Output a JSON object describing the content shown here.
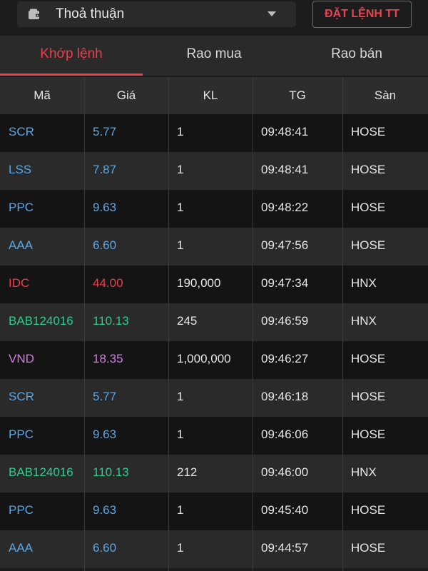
{
  "header": {
    "select_label": "Thoả thuận",
    "order_button_label": "ĐẶT LỆNH TT"
  },
  "tabs": [
    {
      "label": "Khớp lệnh",
      "active": true
    },
    {
      "label": "Rao mua",
      "active": false
    },
    {
      "label": "Rao bán",
      "active": false
    }
  ],
  "table": {
    "columns": [
      "Mã",
      "Giá",
      "KL",
      "TG",
      "Sàn"
    ],
    "colors": {
      "blue": "#5aa6e6",
      "red": "#ee3d4b",
      "green": "#2ecc8f",
      "purple": "#d678e8"
    },
    "rows": [
      {
        "symbol": "SCR",
        "price": "5.77",
        "volume": "1",
        "time": "09:48:41",
        "exchange": "HOSE",
        "color": "blue"
      },
      {
        "symbol": "LSS",
        "price": "7.87",
        "volume": "1",
        "time": "09:48:41",
        "exchange": "HOSE",
        "color": "blue"
      },
      {
        "symbol": "PPC",
        "price": "9.63",
        "volume": "1",
        "time": "09:48:22",
        "exchange": "HOSE",
        "color": "blue"
      },
      {
        "symbol": "AAA",
        "price": "6.60",
        "volume": "1",
        "time": "09:47:56",
        "exchange": "HOSE",
        "color": "blue"
      },
      {
        "symbol": "IDC",
        "price": "44.00",
        "volume": "190,000",
        "time": "09:47:34",
        "exchange": "HNX",
        "color": "red"
      },
      {
        "symbol": "BAB124016",
        "price": "110.13",
        "volume": "245",
        "time": "09:46:59",
        "exchange": "HNX",
        "color": "green"
      },
      {
        "symbol": "VND",
        "price": "18.35",
        "volume": "1,000,000",
        "time": "09:46:27",
        "exchange": "HOSE",
        "color": "purple"
      },
      {
        "symbol": "SCR",
        "price": "5.77",
        "volume": "1",
        "time": "09:46:18",
        "exchange": "HOSE",
        "color": "blue"
      },
      {
        "symbol": "PPC",
        "price": "9.63",
        "volume": "1",
        "time": "09:46:06",
        "exchange": "HOSE",
        "color": "blue"
      },
      {
        "symbol": "BAB124016",
        "price": "110.13",
        "volume": "212",
        "time": "09:46:00",
        "exchange": "HNX",
        "color": "green"
      },
      {
        "symbol": "PPC",
        "price": "9.63",
        "volume": "1",
        "time": "09:45:40",
        "exchange": "HOSE",
        "color": "blue"
      },
      {
        "symbol": "AAA",
        "price": "6.60",
        "volume": "1",
        "time": "09:44:57",
        "exchange": "HOSE",
        "color": "blue"
      }
    ]
  }
}
